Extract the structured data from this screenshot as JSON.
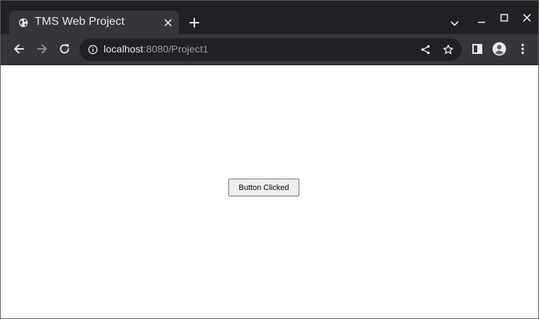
{
  "browser": {
    "tab": {
      "title": "TMS Web Project",
      "favicon": "globe-icon"
    },
    "window_controls": [
      "tab-search-icon",
      "minimize-icon",
      "maximize-icon",
      "close-icon"
    ],
    "toolbar": {
      "url_host": "localhost",
      "url_rest": ":8080/Project1",
      "icons": [
        "back-icon",
        "forward-icon",
        "reload-icon",
        "site-info-icon",
        "share-icon",
        "bookmark-star-icon",
        "side-panel-icon",
        "profile-icon",
        "menu-icon"
      ]
    }
  },
  "page": {
    "button_label": "Button Clicked"
  },
  "colors": {
    "tab_strip": "#202124",
    "toolbar": "#35363a",
    "omnibox": "#202124",
    "page_background": "#ffffff"
  }
}
